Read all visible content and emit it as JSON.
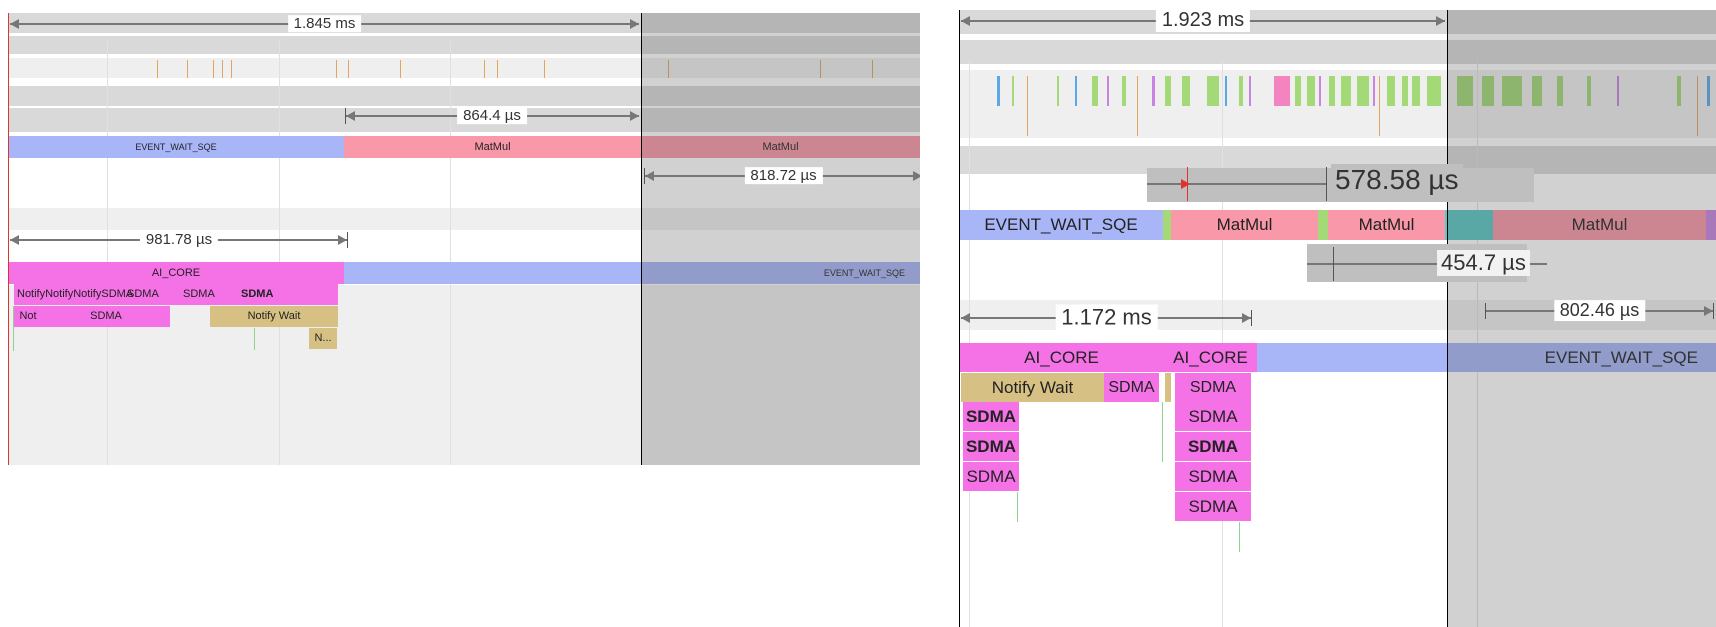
{
  "left": {
    "measure_total": "1.845 ms",
    "measure_b": "864.4 µs",
    "measure_c": "818.72 µs",
    "measure_d": "981.78 µs",
    "seg_event_wait": "EVENT_WAIT_SQE",
    "seg_matmul_1": "MatMul",
    "seg_matmul_2": "MatMul",
    "seg_ai_core": "AI_CORE",
    "seg_event_wait_2": "EVENT_WAIT_SQE",
    "row1_overlap": "NotifyNotifyNotifySDMA",
    "row1_sdma_a": "SDMA",
    "row1_sdma_b": "SDMA",
    "row1_sdma_c": "SDMA",
    "row2_not": "Not",
    "row2_sdma": "SDMA",
    "row2_notify": "Notify Wait",
    "row3_n": "N..."
  },
  "right": {
    "measure_total": "1.923 ms",
    "measure_b": "578.58 µs",
    "measure_c": "454.7 µs",
    "measure_d": "1.172 ms",
    "measure_e": "802.46 µs",
    "seg_event_wait": "EVENT_WAIT_SQE",
    "seg_matmul_1": "MatMul",
    "seg_matmul_2": "MatMul",
    "seg_matmul_3": "MatMul",
    "seg_ai_core_1": "AI_CORE",
    "seg_ai_core_2": "AI_CORE",
    "seg_event_wait_2": "EVENT_WAIT_SQE",
    "row1_notify": "Notify Wait",
    "row1_sdma_a": "SDMA",
    "row1_sdma_b": "SDMA",
    "col1": [
      "SDMA",
      "SDMA",
      "SDMA"
    ],
    "col2": [
      "SDMA",
      "SDMA",
      "SDMA",
      "SDMA"
    ]
  },
  "colors": {
    "event_wait": "#a8b6f7",
    "matmul": "#f898a8",
    "ai_core": "#f472e6",
    "notify_wait": "#d6c083",
    "selection_shade": "#8c8c8c"
  }
}
